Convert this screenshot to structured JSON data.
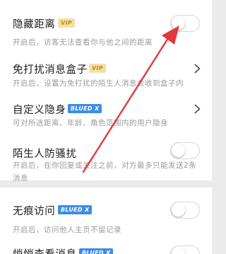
{
  "settings": [
    {
      "title": "隐藏距离",
      "badge": "VIP",
      "badge_type": "vip",
      "control": "toggle",
      "toggle_on": false,
      "desc": "开启后，访客无法查看你与他之间的距离"
    },
    {
      "title": "免打扰消息盒子",
      "badge": "VIP",
      "badge_type": "vip",
      "control": "chevron",
      "desc": "开启后，设置为免打扰的陌生人消息会收到盒子内"
    },
    {
      "title": "自定义隐身",
      "badge": "BLUED X",
      "badge_type": "blued",
      "control": "chevron",
      "desc": "可对所选距离、年龄、角色范围内的用户隐身"
    },
    {
      "title": "陌生人防骚扰",
      "control": "toggle",
      "toggle_on": false,
      "desc": "开启后，在你回复或关注之前，对方最多只能发送2条消息"
    },
    {
      "title": "无痕访问",
      "badge": "BLUED X",
      "badge_type": "blued",
      "control": "toggle",
      "toggle_on": false,
      "desc": "开启后，访问他人主页不留记录"
    },
    {
      "title": "悄悄查看消息",
      "badge": "BLUED X",
      "badge_type": "blued",
      "control": "toggle",
      "toggle_on": false
    }
  ],
  "colors": {
    "vip_badge_bg": "#f4dfa9",
    "vip_badge_text": "#c28c14",
    "blued_badge_bg": "#3b8de8",
    "annotation_arrow": "#e0393e",
    "page_bg": "#ebebeb"
  },
  "icons": [
    "chevron-right-icon",
    "toggle-switch"
  ],
  "annotation": "red-arrow-pointing-to-hidden-distance-toggle"
}
